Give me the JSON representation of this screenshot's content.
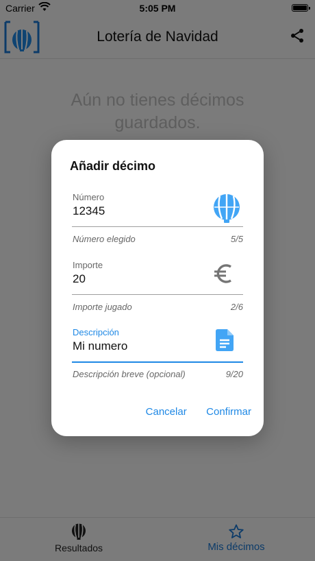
{
  "status_bar": {
    "carrier": "Carrier",
    "time": "5:05 PM"
  },
  "app_bar": {
    "title": "Lotería de Navidad"
  },
  "empty_state": {
    "message": "Aún no tienes décimos guardados."
  },
  "bottom_nav": {
    "items": [
      {
        "label": "Resultados",
        "icon": "balloon-icon",
        "selected": false
      },
      {
        "label": "Mis décimos",
        "icon": "star-outline-icon",
        "selected": true
      }
    ]
  },
  "dialog": {
    "title": "Añadir décimo",
    "fields": [
      {
        "label": "Número",
        "value": "12345",
        "helper": "Número elegido",
        "counter": "5/5",
        "icon": "balloon-icon",
        "active": false
      },
      {
        "label": "Importe",
        "value": "20",
        "helper": "Importe jugado",
        "counter": "2/6",
        "icon": "euro-icon",
        "active": false
      },
      {
        "label": "Descripción",
        "value": "Mi numero",
        "helper": "Descripción breve (opcional)",
        "counter": "9/20",
        "icon": "document-icon",
        "active": true
      }
    ],
    "actions": {
      "cancel": "Cancelar",
      "confirm": "Confirmar"
    }
  },
  "colors": {
    "accent": "#1e88e5",
    "brand_blue": "#1976d2",
    "empty_text": "#bdbdbd",
    "scrim": "rgba(0,0,0,0.5)"
  }
}
